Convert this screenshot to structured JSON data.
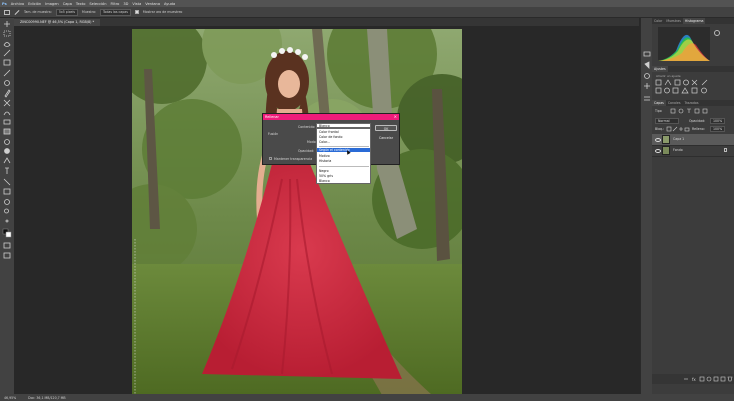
{
  "menubar": {
    "items": [
      "Archivo",
      "Edición",
      "Imagen",
      "Capa",
      "Texto",
      "Selección",
      "Filtro",
      "3D",
      "Vista",
      "Ventana",
      "Ayuda"
    ]
  },
  "options": {
    "size_label": "Tam. de muestra:",
    "size_value": "5x5 pixels",
    "sample_label": "Muestra:",
    "sample_value": "Todas las capas",
    "show_ring_label": "Mostrar aro de muestreo"
  },
  "document": {
    "tab_title": "ZINC00990.NEF @ 46,5% (Capa 1, RGB/8) *"
  },
  "status": {
    "zoom": "46,95%",
    "doc": "Doc: 36,1 MB/120,7 MB"
  },
  "panels": {
    "top_tabs": [
      "Color",
      "Muestras",
      "Histograma"
    ],
    "adjust_title": "Ajustes",
    "adjust_subtitle": "Añadir un ajuste",
    "layer_tabs": [
      "Capas",
      "Canales",
      "Trazados"
    ],
    "kind_label": "Tipo",
    "blend_label": "Normal",
    "opacity_label": "Opacidad:",
    "opacity_value": "100%",
    "lock_label": "Bloq.:",
    "fill_label": "Relleno:",
    "fill_value": "100%",
    "layers": [
      {
        "name": "Capa 1"
      },
      {
        "name": "Fondo"
      }
    ]
  },
  "dialog": {
    "title": "Rellenar",
    "content_label": "Contenido:",
    "content_value": "Blanco",
    "fusion_label": "Fusión",
    "mode_label": "Modo:",
    "opacity_label": "Opacidad:",
    "preserve_label": "Mantener transparencia",
    "ok_label": "OK",
    "cancel_label": "Cancelar",
    "options": [
      "Color frontal",
      "Color de fondo",
      "Color...",
      "Según el contenido",
      "Motivo",
      "Historia",
      "Negro",
      "50% gris",
      "Blanco"
    ],
    "selected_index": 3
  },
  "colors": {
    "dialog_accent": "#ee1c7a",
    "selection": "#2a6bd6",
    "dress": "#c8263a"
  }
}
